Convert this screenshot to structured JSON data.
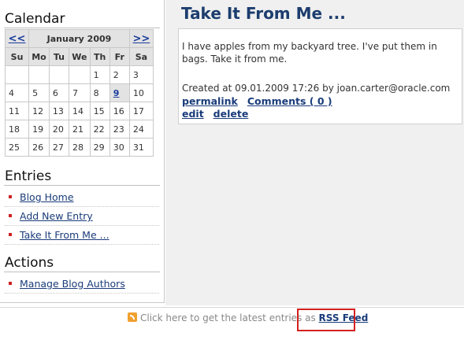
{
  "sidebar": {
    "calendar_title": "Calendar",
    "calendar": {
      "prev": "<<",
      "month": "January 2009",
      "next": ">>",
      "weekdays": [
        "Su",
        "Mo",
        "Tu",
        "We",
        "Th",
        "Fr",
        "Sa"
      ],
      "weeks": [
        [
          "",
          "",
          "",
          "",
          "1",
          "2",
          "3"
        ],
        [
          "4",
          "5",
          "6",
          "7",
          "8",
          "9",
          "10"
        ],
        [
          "11",
          "12",
          "13",
          "14",
          "15",
          "16",
          "17"
        ],
        [
          "18",
          "19",
          "20",
          "21",
          "22",
          "23",
          "24"
        ],
        [
          "25",
          "26",
          "27",
          "28",
          "29",
          "30",
          "31"
        ]
      ],
      "highlighted_day": "9"
    },
    "entries_title": "Entries",
    "entries": [
      {
        "label": "Blog Home"
      },
      {
        "label": "Add New Entry"
      },
      {
        "label": "Take It From Me ..."
      }
    ],
    "actions_title": "Actions",
    "actions": [
      {
        "label": "Manage Blog Authors"
      }
    ]
  },
  "post": {
    "title": "Take It From Me ...",
    "body": "I have apples from my backyard tree. I've put them in bags. Take it from me.",
    "meta": "Created at 09.01.2009 17:26 by joan.carter@oracle.com",
    "permalink": "permalink",
    "comments": "Comments ( 0 )",
    "edit": "edit",
    "delete": "delete"
  },
  "footer": {
    "text": "Click here to get the latest entries as",
    "rss_link": "RSS Feed",
    "icon": "rss-icon"
  }
}
